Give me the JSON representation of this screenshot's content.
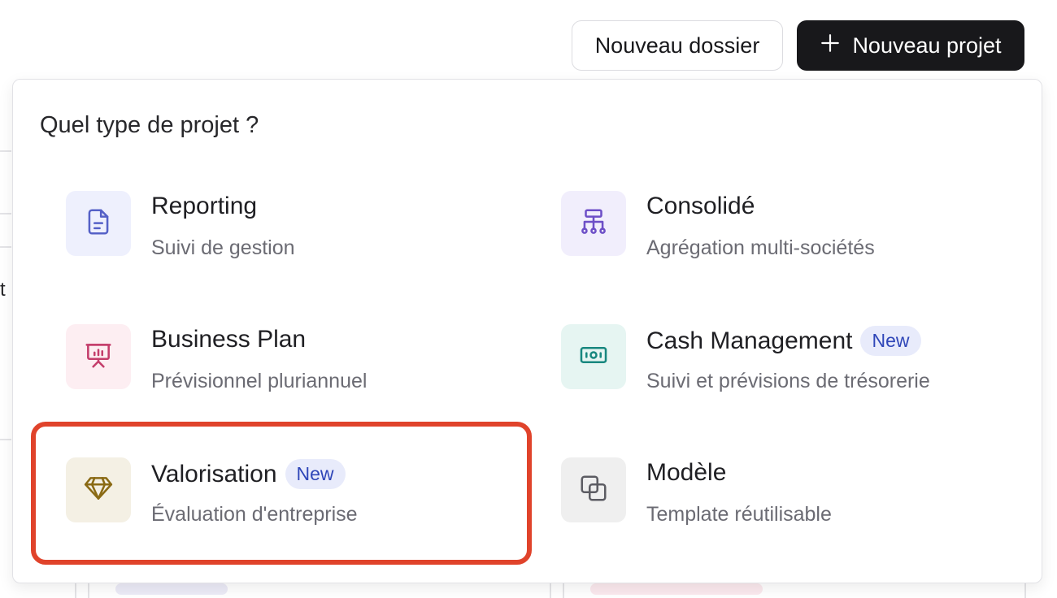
{
  "header": {
    "new_folder_label": "Nouveau dossier",
    "new_project_label": "Nouveau projet"
  },
  "background": {
    "partial_letter": "t"
  },
  "popover": {
    "title": "Quel type de projet ?",
    "options": [
      {
        "label": "Reporting",
        "description": "Suivi de gestion",
        "icon": "document-icon",
        "badge": null,
        "icon_color": "#5561c7",
        "icon_bg": "#eef0fd"
      },
      {
        "label": "Consolidé",
        "description": "Agrégation multi-sociétés",
        "icon": "hierarchy-icon",
        "badge": null,
        "icon_color": "#6d4fc7",
        "icon_bg": "#f1eefc"
      },
      {
        "label": "Business Plan",
        "description": "Prévisionnel pluriannuel",
        "icon": "presentation-chart-icon",
        "badge": null,
        "icon_color": "#c43d6b",
        "icon_bg": "#fdeef2"
      },
      {
        "label": "Cash Management",
        "description": "Suivi et prévisions de trésorerie",
        "icon": "banknote-icon",
        "badge": "New",
        "icon_color": "#18877f",
        "icon_bg": "#e6f5f2"
      },
      {
        "label": "Valorisation",
        "description": "Évaluation d'entreprise",
        "icon": "diamond-icon",
        "badge": "New",
        "icon_color": "#8a6a14",
        "icon_bg": "#f4f0e4"
      },
      {
        "label": "Modèle",
        "description": "Template réutilisable",
        "icon": "copy-icon",
        "badge": null,
        "icon_color": "#5c5c63",
        "icon_bg": "#efefef"
      }
    ]
  },
  "colors": {
    "highlight": "#e0432b",
    "primary_button": "#18181b",
    "badge_bg": "#e8ebfb",
    "badge_text": "#2f46b8"
  }
}
